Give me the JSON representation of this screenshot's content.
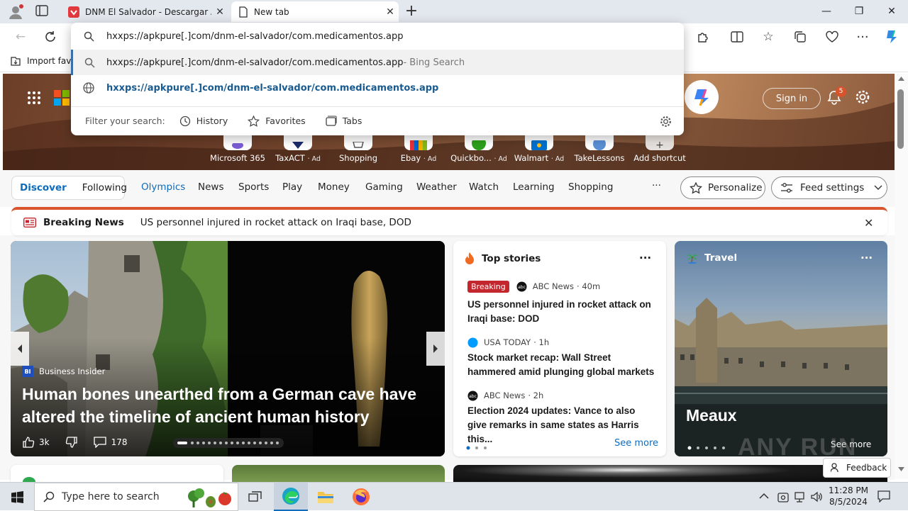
{
  "browser": {
    "tabs": [
      {
        "title": "DNM El Salvador - Descargar APK para Android | APKPure",
        "close": "✕"
      },
      {
        "title": "New tab",
        "close": "✕"
      }
    ],
    "new_tab_symbol": "+",
    "window_controls": {
      "minimize": "—",
      "restore": "❐",
      "close": "✕"
    }
  },
  "omnibox": {
    "input_value": "hxxps://apkpure[.]com/dnm-el-salvador/com.medicamentos.app",
    "suggestions": [
      {
        "text": "hxxps://apkpure[.]com/dnm-el-salvador/com.medicamentos.app",
        "suffix": " - Bing Search"
      },
      {
        "text": "hxxps://apkpure[.]com/dnm-el-salvador/com.medicamentos.app",
        "suffix": ""
      }
    ],
    "filter_label": "Filter your search:",
    "filters": [
      "History",
      "Favorites",
      "Tabs"
    ]
  },
  "favorites_bar": {
    "import_label": "Import favo"
  },
  "header": {
    "sign_in": "Sign in",
    "notification_count": "5"
  },
  "shortcuts": [
    {
      "label": "Microsoft 365",
      "ad": ""
    },
    {
      "label": "TaxACT",
      "ad": "· Ad"
    },
    {
      "label": "Shopping",
      "ad": ""
    },
    {
      "label": "Ebay",
      "ad": "· Ad"
    },
    {
      "label": "Quickbo...",
      "ad": "· Ad"
    },
    {
      "label": "Walmart",
      "ad": "· Ad"
    },
    {
      "label": "TakeLessons",
      "ad": ""
    },
    {
      "label": "Add shortcut",
      "ad": ""
    }
  ],
  "feed_nav": {
    "discover": "Discover",
    "following": "Following",
    "items": [
      "Olympics",
      "News",
      "Sports",
      "Play",
      "Money",
      "Gaming",
      "Weather",
      "Watch",
      "Learning",
      "Shopping"
    ],
    "more": "···",
    "personalize": "Personalize",
    "feed_settings": "Feed settings"
  },
  "breaking": {
    "label": "Breaking News",
    "headline": "US personnel injured in rocket attack on Iraqi base, DOD"
  },
  "main_story": {
    "source_badge": "BI",
    "source": "Business Insider",
    "title": "Human bones unearthed from a German cave have altered the timeline of ancient human history",
    "likes": "3k",
    "comments": "178"
  },
  "top_stories": {
    "title": "Top stories",
    "more": "···",
    "items": [
      {
        "badge": "Breaking",
        "source": "ABC News",
        "time": "· 40m",
        "title": "US personnel injured in rocket attack on Iraqi base: DOD"
      },
      {
        "badge": "",
        "source": "USA TODAY",
        "time": "· 1h",
        "title": "Stock market recap: Wall Street hammered amid plunging global markets"
      },
      {
        "badge": "",
        "source": "ABC News",
        "time": "· 2h",
        "title": "Election 2024 updates: Vance to also give remarks in same states as Harris this..."
      }
    ],
    "see_more": "See more"
  },
  "travel": {
    "label": "Travel",
    "more": "···",
    "title": "Meaux",
    "see_more": "See more"
  },
  "feedback": "Feedback",
  "watermark": "ANY RUN",
  "taskbar": {
    "search_placeholder": "Type here to search",
    "time": "11:28 PM",
    "date": "8/5/2024"
  },
  "colors": {
    "accent_blue": "#0f6cbd",
    "breaking_red": "#c4262e",
    "breaking_bar": "#d9532c"
  }
}
